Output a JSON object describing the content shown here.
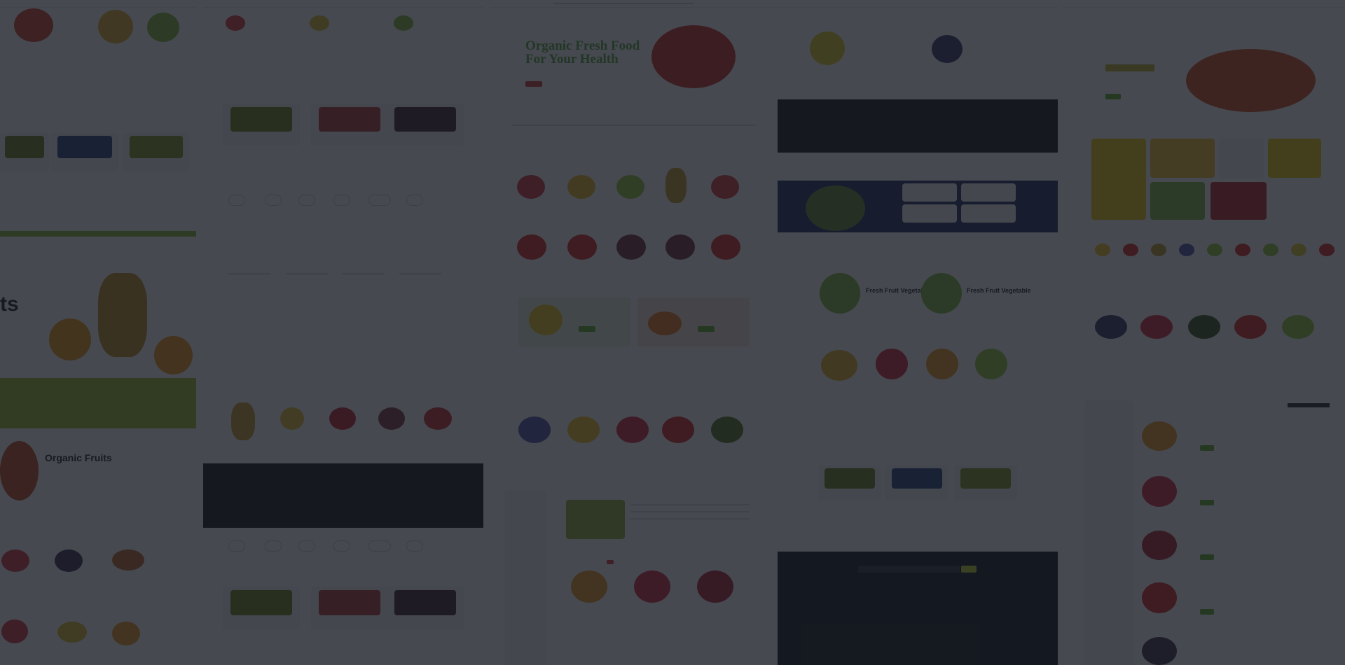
{
  "page": {
    "theme": "organic fruit store template preview"
  },
  "panels": {
    "left_partial": {
      "hero_word": "ts",
      "section_title": "Organic Fruits"
    },
    "center": {
      "hero_title_line1": "Organic Fresh Food",
      "hero_title_line2": "For Your Health"
    },
    "right_mid": {
      "card1_title": "Fresh Fruit Vegetable",
      "card2_title": "Fresh Fruit Vegetable"
    }
  },
  "colors": {
    "accent": "#63b235",
    "overlay": "rgba(18,22,30,0.78)",
    "sale": "#e04545"
  }
}
